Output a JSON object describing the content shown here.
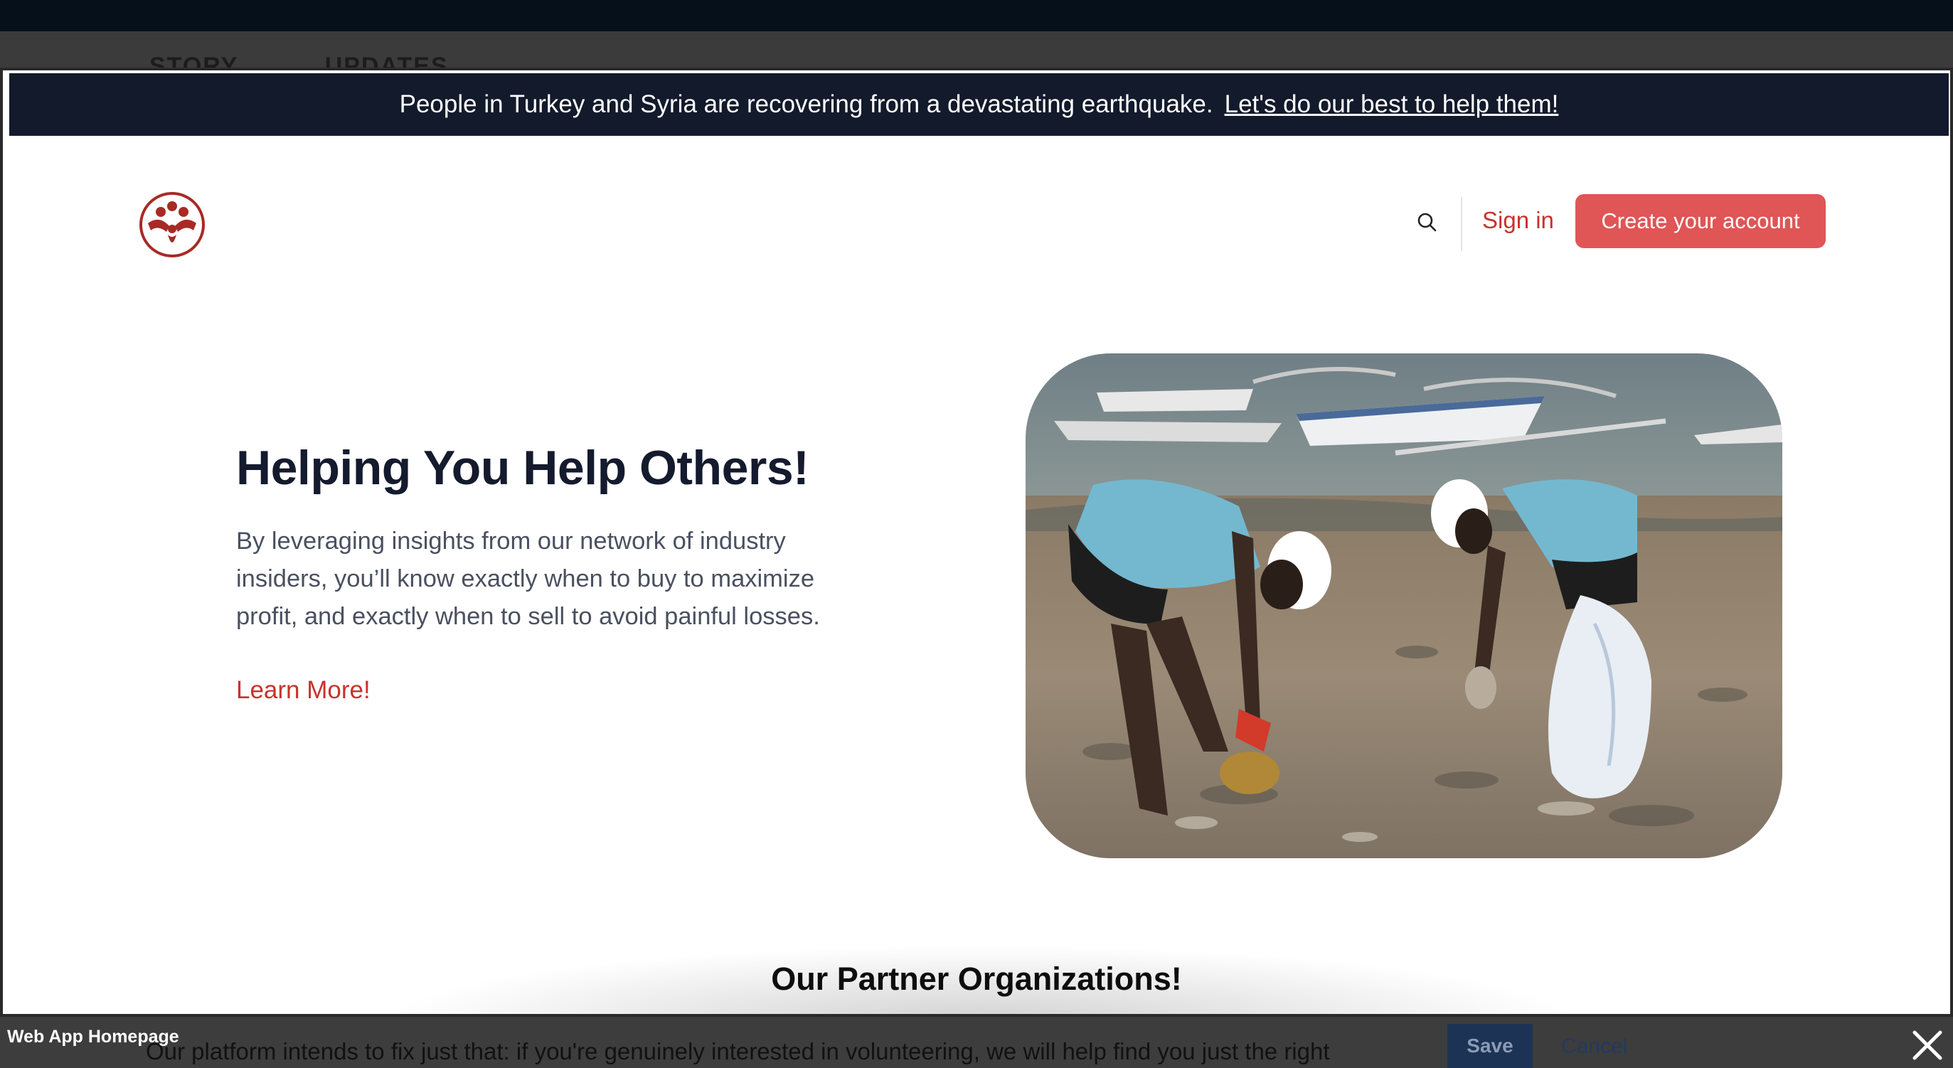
{
  "background_tabs": [
    "STORY",
    "UPDATES"
  ],
  "announcement": {
    "message": "People in Turkey and Syria are recovering from a devastating earthquake.",
    "link": "Let's do our best to help them!"
  },
  "nav": {
    "sign_in": "Sign in",
    "create_account": "Create your account"
  },
  "hero": {
    "title": "Helping You Help Others!",
    "description": "By leveraging insights from our network of industry insiders, you’ll know exactly when to buy to maximize profit, and exactly when to sell to avoid painful losses.",
    "cta": "Learn More!"
  },
  "partners": {
    "title": "Our Partner Organizations!"
  },
  "footer": {
    "label": "Web App Homepage",
    "save": "Save",
    "cancel": "Cancel",
    "background_text": "Our platform intends to fix just that: if you're genuinely interested in volunteering, we will help find you just the right"
  },
  "colors": {
    "brand_red": "#c8322c",
    "button_red": "#e05555",
    "banner_navy": "#121a2b"
  }
}
